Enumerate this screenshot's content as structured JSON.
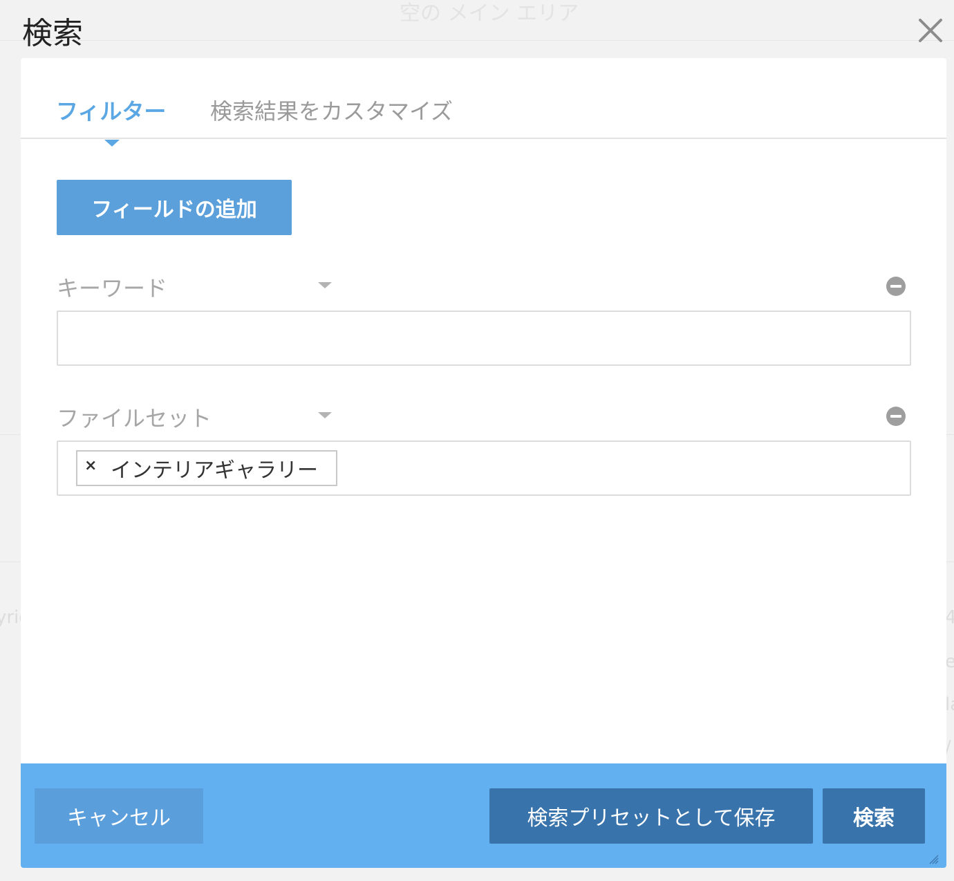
{
  "background": {
    "title": "空の メイン エリア",
    "fragment_left": "yrig",
    "fragments_right": [
      "4",
      "e",
      "la",
      "/"
    ]
  },
  "dialog": {
    "title": "検索",
    "close_icon": "close-icon"
  },
  "tabs": [
    {
      "label": "フィルター",
      "active": true
    },
    {
      "label": "検索結果をカスタマイズ",
      "active": false
    }
  ],
  "add_field_label": "フィールドの追加",
  "fields": [
    {
      "label": "キーワード",
      "value": ""
    },
    {
      "label": "ファイルセット",
      "chips": [
        {
          "remove_glyph": "×",
          "label": "インテリアギャラリー"
        }
      ]
    }
  ],
  "footer": {
    "cancel_label": "キャンセル",
    "save_preset_label": "検索プリセットとして保存",
    "search_label": "検索"
  },
  "colors": {
    "accent": "#5aa7e4",
    "primary_button": "#5b9fdb",
    "footer_bg": "#63b0f1",
    "footer_dark_button": "#3873ab"
  }
}
